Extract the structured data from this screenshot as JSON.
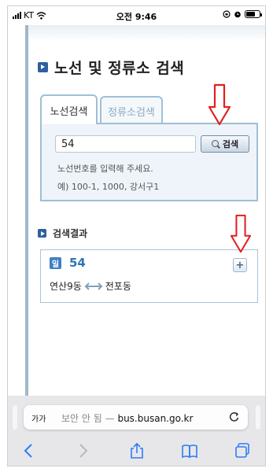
{
  "status_bar": {
    "carrier": "KT",
    "time": "오전 9:46"
  },
  "page": {
    "title": "노선 및 정류소 검색"
  },
  "tabs": [
    {
      "label": "노선검색",
      "active": true
    },
    {
      "label": "정류소검색",
      "active": false
    }
  ],
  "search": {
    "value": "54",
    "button_label": "검색",
    "hint_line1": "노선번호를 입력해 주세요.",
    "hint_line2": "예) 100-1, 1000, 강서구1"
  },
  "results": {
    "heading": "검색결과",
    "items": [
      {
        "badge": "일",
        "route_number": "54",
        "origin": "연산9동",
        "destination": "전포동",
        "add_label": "+"
      }
    ]
  },
  "browser": {
    "text_size_label": "가가",
    "security_label": "보안 안 됨",
    "separator": "—",
    "domain": "bus.busan.go.kr"
  },
  "colors": {
    "accent_blue": "#2f74b5",
    "tab_border": "#9fbfd6",
    "annotation_red": "#e02020"
  },
  "icons": {
    "wifi": "wifi-icon",
    "battery": "battery-icon",
    "search": "magnifier-icon",
    "swap": "double-arrow-icon",
    "reload": "reload-icon",
    "back": "chevron-left-icon",
    "forward": "chevron-right-icon",
    "share": "share-icon",
    "bookmarks": "book-icon",
    "tabs": "tabs-icon"
  }
}
